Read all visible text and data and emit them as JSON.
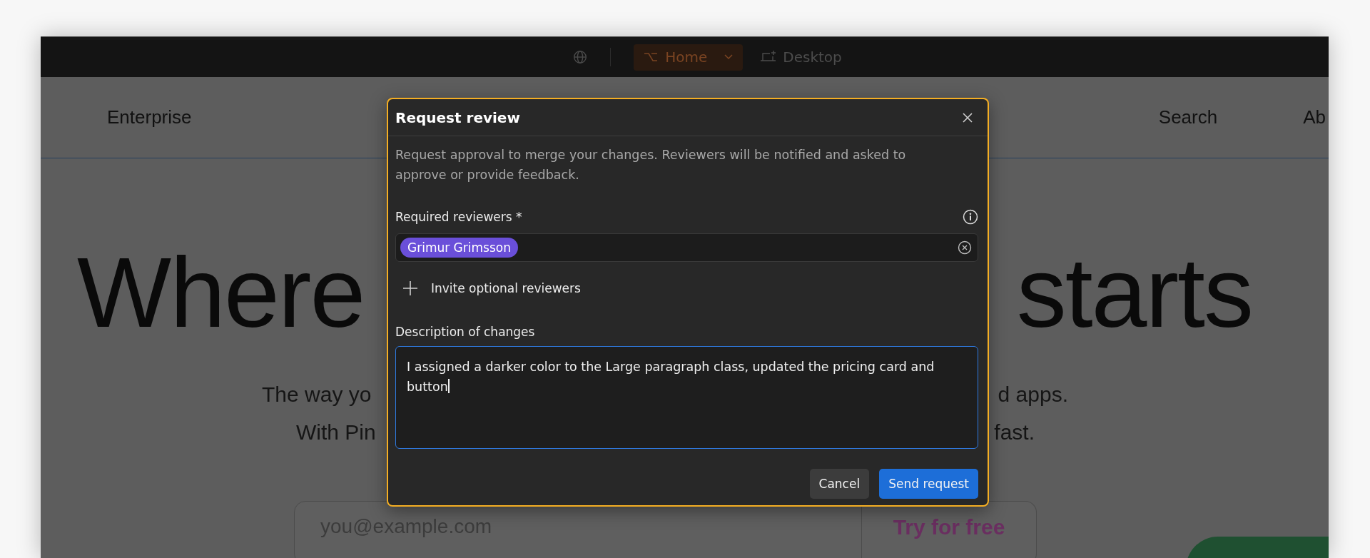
{
  "top_bar": {
    "branch": {
      "label": "Home",
      "selected": true
    },
    "breakpoint": {
      "label": "Desktop"
    }
  },
  "site": {
    "nav": {
      "left": "Enterprise",
      "right": [
        "Search",
        "Ab"
      ]
    },
    "hero": {
      "headline_left": "Where",
      "headline_right": "starts",
      "subtitle_lines": [
        {
          "left": "The way yo",
          "right": "d apps."
        },
        {
          "left": "With Pin",
          "right": "fast."
        }
      ],
      "signup": {
        "placeholder": "you@example.com",
        "button": "Try for free"
      }
    }
  },
  "dialog": {
    "title": "Request review",
    "description": "Request approval to merge your changes. Reviewers will be notified and asked to approve or provide feedback.",
    "required_label": "Required reviewers",
    "required_mark": "*",
    "reviewers": [
      {
        "name": "Grimur Grimsson"
      }
    ],
    "invite_label": "Invite optional reviewers",
    "description_label": "Description of changes",
    "description_value": "I assigned a darker color to the Large paragraph class, updated the pricing card and button",
    "description_focused": true,
    "buttons": [
      {
        "label": "Cancel",
        "kind": "secondary"
      },
      {
        "label": "Send request",
        "kind": "primary"
      }
    ]
  }
}
